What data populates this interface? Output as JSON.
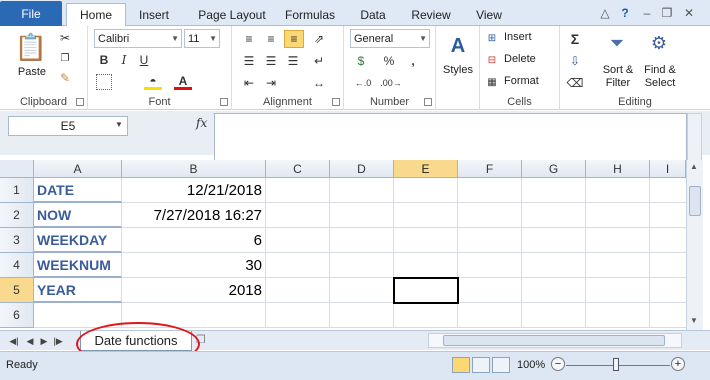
{
  "ribbon_tabs": {
    "file": "File",
    "home": "Home",
    "insert": "Insert",
    "page_layout": "Page Layout",
    "formulas": "Formulas",
    "data": "Data",
    "review": "Review",
    "view": "View"
  },
  "clipboard": {
    "paste": "Paste",
    "group": "Clipboard"
  },
  "font": {
    "family": "Calibri",
    "size": "11",
    "group": "Font",
    "bold": "B",
    "italic": "I",
    "underline": "U"
  },
  "alignment": {
    "group": "Alignment"
  },
  "number": {
    "format": "General",
    "group": "Number",
    "dollar": "$",
    "percent": "%",
    "comma": ","
  },
  "styles": {
    "label": "Styles"
  },
  "cells": {
    "insert": "Insert",
    "delete": "Delete",
    "format": "Format",
    "group": "Cells"
  },
  "editing": {
    "sum": "Σ",
    "sort_filter": "Sort &",
    "sort_filter2": "Filter",
    "find_select": "Find &",
    "find_select2": "Select",
    "group": "Editing"
  },
  "formula_bar": {
    "name_box": "E5",
    "fx": "fx",
    "value": ""
  },
  "columns": [
    "A",
    "B",
    "C",
    "D",
    "E",
    "F",
    "G",
    "H",
    "I"
  ],
  "rows": [
    "1",
    "2",
    "3",
    "4",
    "5",
    "6"
  ],
  "cells_data": {
    "A1": "DATE",
    "B1": "12/21/2018",
    "A2": "NOW",
    "B2": "7/27/2018 16:27",
    "A3": "WEEKDAY",
    "B3": "6",
    "A4": "WEEKNUM",
    "B4": "30",
    "A5": "YEAR",
    "B5": "2018"
  },
  "selected_cell": "E5",
  "sheet_tab": "Date functions",
  "status": {
    "ready": "Ready",
    "zoom": "100%",
    "minus": "−",
    "plus": "+"
  },
  "colors": {
    "file_tab": "#2a6ab5",
    "label_text": "#3a5d9a",
    "header_selected": "#f9d98d",
    "highlight_circle": "#e0161b"
  }
}
